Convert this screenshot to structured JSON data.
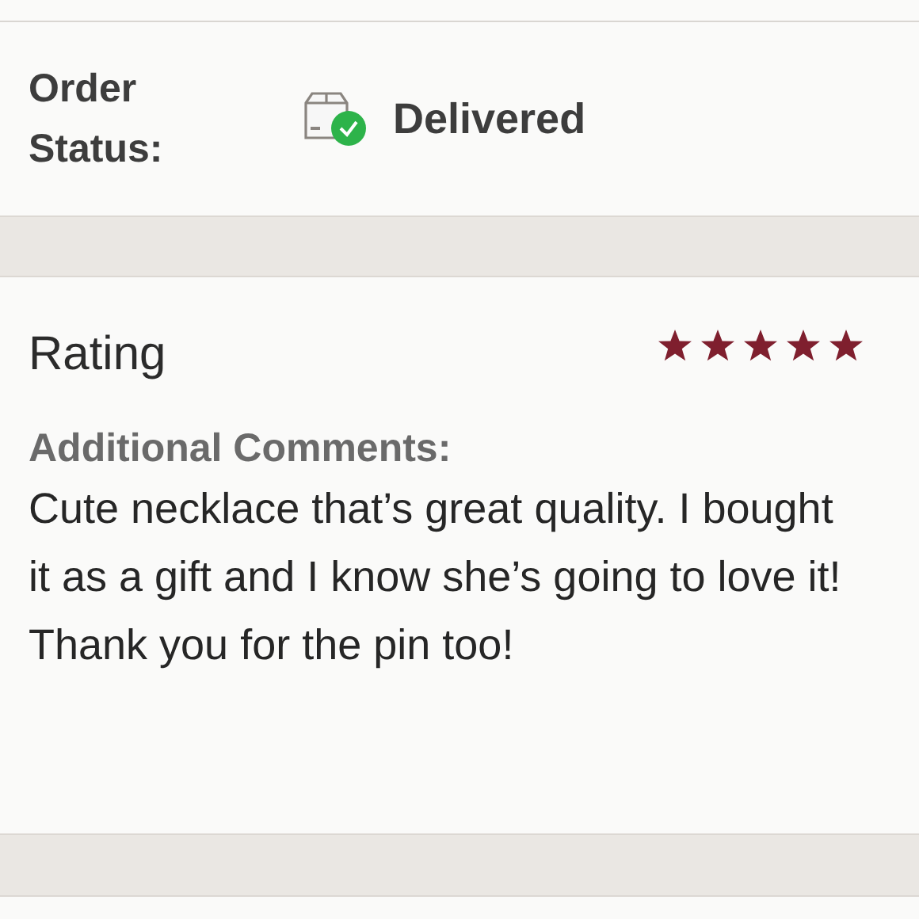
{
  "order_status": {
    "label": "Order Status:",
    "value": "Delivered"
  },
  "rating": {
    "label": "Rating",
    "stars": 5
  },
  "comments": {
    "label": "Additional Comments:",
    "text": "Cute necklace that’s great quality. I bought it as a gift and I know she’s going to love it! Thank you for the pin too!"
  }
}
